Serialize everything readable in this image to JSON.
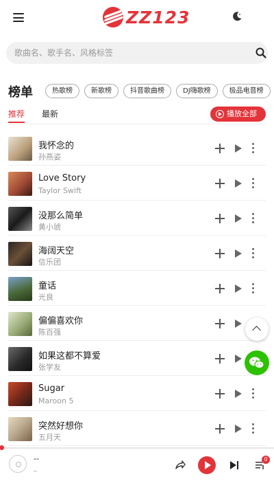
{
  "header": {
    "logo_text": "ZZ123",
    "brand_color": "#e3343a",
    "menu_icon": "hamburger-icon",
    "theme_icon": "moon-icon"
  },
  "search": {
    "placeholder": "歌曲名、歌手名、风格标签",
    "icon": "search-icon"
  },
  "charts": {
    "title": "榜单",
    "chips": [
      "热歌榜",
      "新歌榜",
      "抖音歌曲榜",
      "DJ嗨歌榜",
      "极品电音榜"
    ]
  },
  "tabs": {
    "recommend": "推荐",
    "latest": "最新",
    "active": "推荐"
  },
  "play_all": {
    "label": "播放全部",
    "icon": "play-circle-icon"
  },
  "songs": [
    {
      "title": "我怀念的",
      "artist": "孙燕姿",
      "cover_color": "#c8b79a"
    },
    {
      "title": "Love Story",
      "artist": "Taylor Swift",
      "cover_color": "#a14a34"
    },
    {
      "title": "没那么简单",
      "artist": "黄小琥",
      "cover_color": "#2a2a2a"
    },
    {
      "title": "海阔天空",
      "artist": "信乐团",
      "cover_color": "#4a3a2a"
    },
    {
      "title": "童话",
      "artist": "光良",
      "cover_color": "#5a7a3a"
    },
    {
      "title": "偏偏喜欢你",
      "artist": "陈百强",
      "cover_color": "#b9c49c"
    },
    {
      "title": "如果这都不算爱",
      "artist": "张学友",
      "cover_color": "#3a3a3a"
    },
    {
      "title": "Sugar",
      "artist": "Maroon 5",
      "cover_color": "#7a2a1a"
    },
    {
      "title": "突然好想你",
      "artist": "五月天",
      "cover_color": "#b8a78c"
    }
  ],
  "floating": {
    "scroll_top_icon": "chevron-up-icon",
    "wechat_icon": "wechat-icon"
  },
  "player": {
    "title": "--",
    "artist": "_",
    "progress": 0,
    "queue_count": "0",
    "icons": [
      "disc-icon",
      "share-icon",
      "play-icon",
      "next-icon",
      "playlist-icon"
    ]
  }
}
